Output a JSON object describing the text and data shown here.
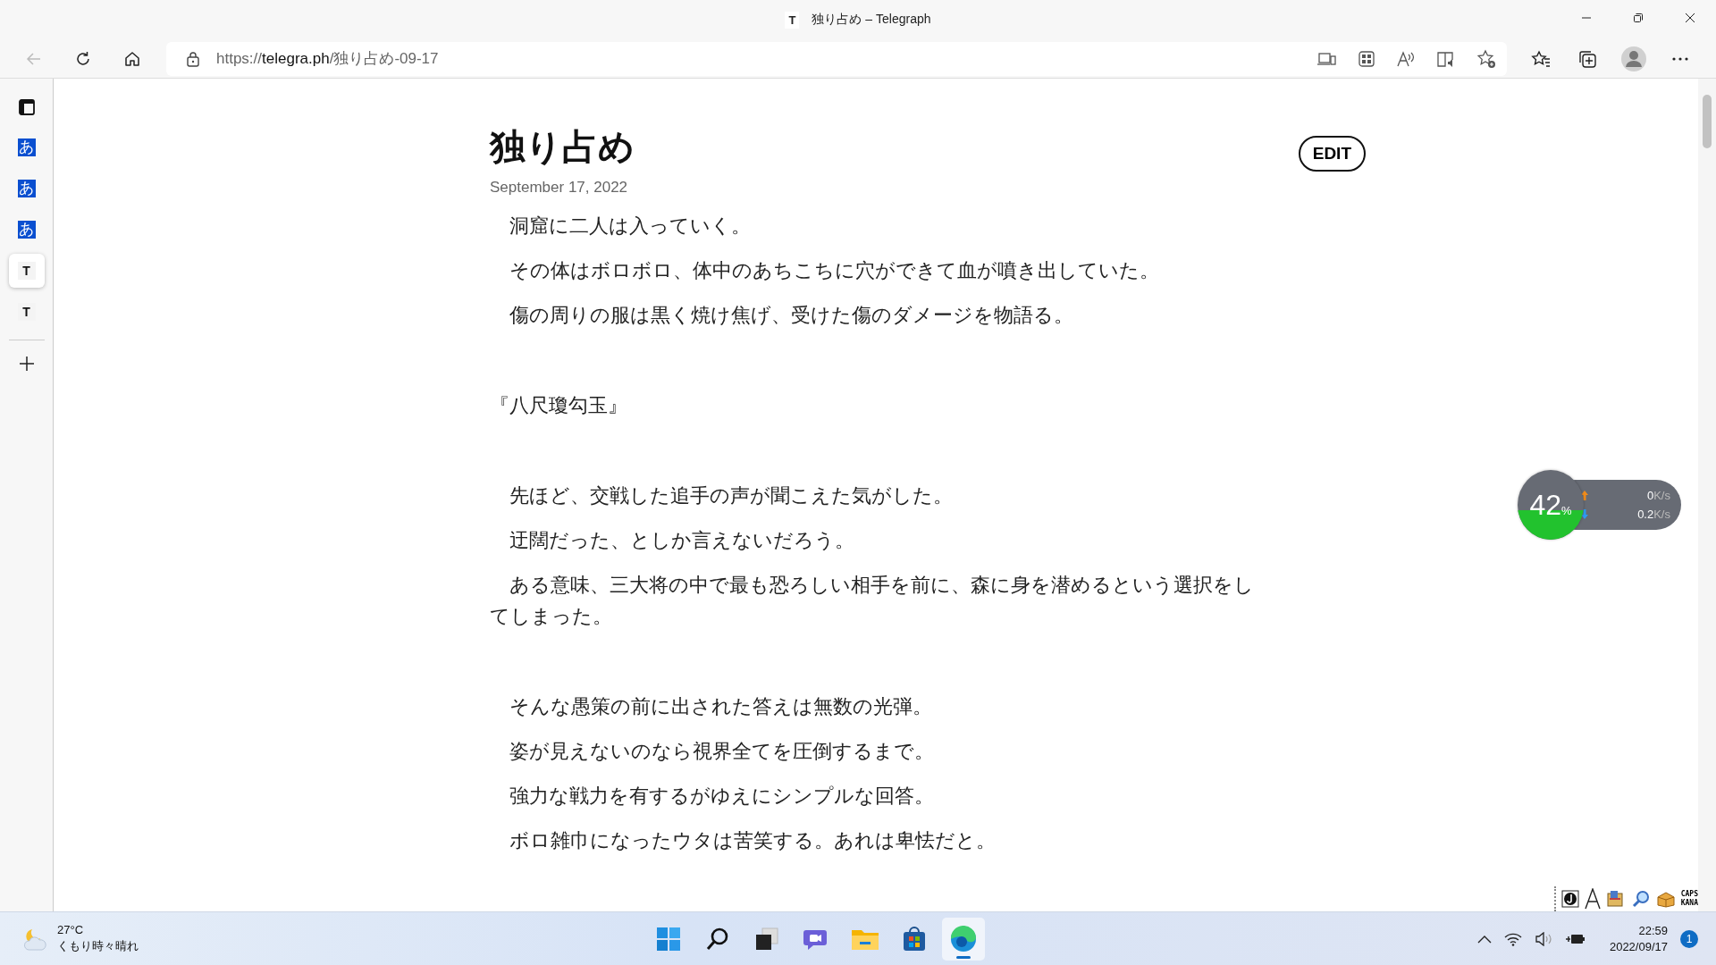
{
  "window": {
    "favicon": "T",
    "title": "独り占め – Telegraph"
  },
  "toolbar": {
    "url_scheme": "https://",
    "url_host": "telegra.ph",
    "url_path": "/独り占め-09-17"
  },
  "vertical_tabs": [
    {
      "kind": "hiragana",
      "glyph": "あ",
      "selected": false
    },
    {
      "kind": "hiragana",
      "glyph": "あ",
      "selected": false
    },
    {
      "kind": "hiragana",
      "glyph": "あ",
      "selected": false
    },
    {
      "kind": "letter",
      "glyph": "T",
      "selected": true
    },
    {
      "kind": "letter",
      "glyph": "T",
      "selected": false
    }
  ],
  "article": {
    "title": "独り占め",
    "date": "September 17, 2022",
    "edit_button": "EDIT",
    "sections": [
      [
        "　洞窟に二人は入っていく。",
        "　その体はボロボロ、体中のあちこちに穴ができて血が噴き出していた。",
        "　傷の周りの服は黒く焼け焦げ、受けた傷のダメージを物語る。"
      ],
      [
        "『八尺瓊勾玉』"
      ],
      [
        "　先ほど、交戦した追手の声が聞こえた気がした。",
        "　迂闊だった、としか言えないだろう。",
        "　ある意味、三大将の中で最も恐ろしい相手を前に、森に身を潜めるという選択をしてしまった。"
      ],
      [
        "　そんな愚策の前に出された答えは無数の光弾。",
        "　姿が見えないのなら視界全てを圧倒するまで。",
        "　強力な戦力を有するがゆえにシンプルな回答。",
        "　ボロ雑巾になったウタは苦笑する。あれは卑怯だと。"
      ]
    ]
  },
  "net_monitor": {
    "level": 0.42,
    "percent": "42",
    "percent_sign": "%",
    "upload": "0",
    "upload_unit": "K/s",
    "download": "0.2",
    "download_unit": "K/s"
  },
  "ime_bar": {
    "caps": "CAPS",
    "kana": "KANA"
  },
  "taskbar": {
    "weather": {
      "temperature": "27°C",
      "condition": "くもり時々晴れ"
    },
    "apps": [
      {
        "kind": "start",
        "selected": false
      },
      {
        "kind": "search",
        "selected": false
      },
      {
        "kind": "taskview",
        "selected": false
      },
      {
        "kind": "chat",
        "selected": false
      },
      {
        "kind": "explorer",
        "selected": false
      },
      {
        "kind": "store",
        "selected": false
      },
      {
        "kind": "edge",
        "selected": true
      }
    ],
    "clock": {
      "time": "22:59",
      "date": "2022/09/17"
    },
    "notification_count": "1"
  }
}
